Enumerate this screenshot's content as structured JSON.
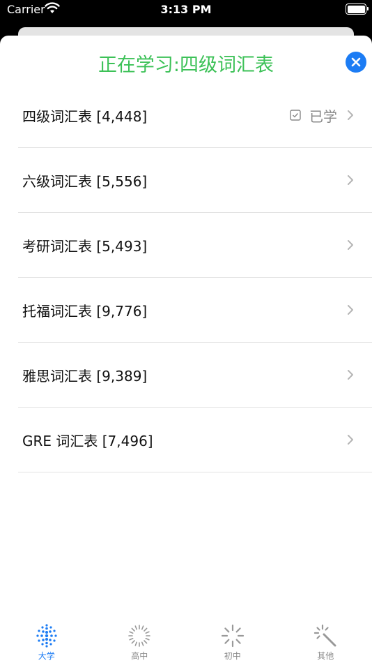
{
  "status_bar": {
    "carrier": "Carrier",
    "time": "3:13 PM"
  },
  "header": {
    "title": "正在学习:四级词汇表",
    "close_icon": "close-icon"
  },
  "list": {
    "items": [
      {
        "label": "四级词汇表 [4,448]",
        "badge": "已学"
      },
      {
        "label": "六级词汇表 [5,556]",
        "badge": ""
      },
      {
        "label": "考研词汇表 [5,493]",
        "badge": ""
      },
      {
        "label": "托福词汇表 [9,776]",
        "badge": ""
      },
      {
        "label": "雅思词汇表 [9,389]",
        "badge": ""
      },
      {
        "label": "GRE 词汇表 [7,496]",
        "badge": ""
      }
    ]
  },
  "tabs": [
    {
      "label": "大学",
      "icon": "dots-grid-icon"
    },
    {
      "label": "高中",
      "icon": "ring-spinner-icon"
    },
    {
      "label": "初中",
      "icon": "spinner-icon"
    },
    {
      "label": "其他",
      "icon": "magic-wand-icon"
    }
  ],
  "colors": {
    "accent_green": "#3cc157",
    "accent_blue": "#1c7cf4",
    "inactive_gray": "#888888"
  }
}
